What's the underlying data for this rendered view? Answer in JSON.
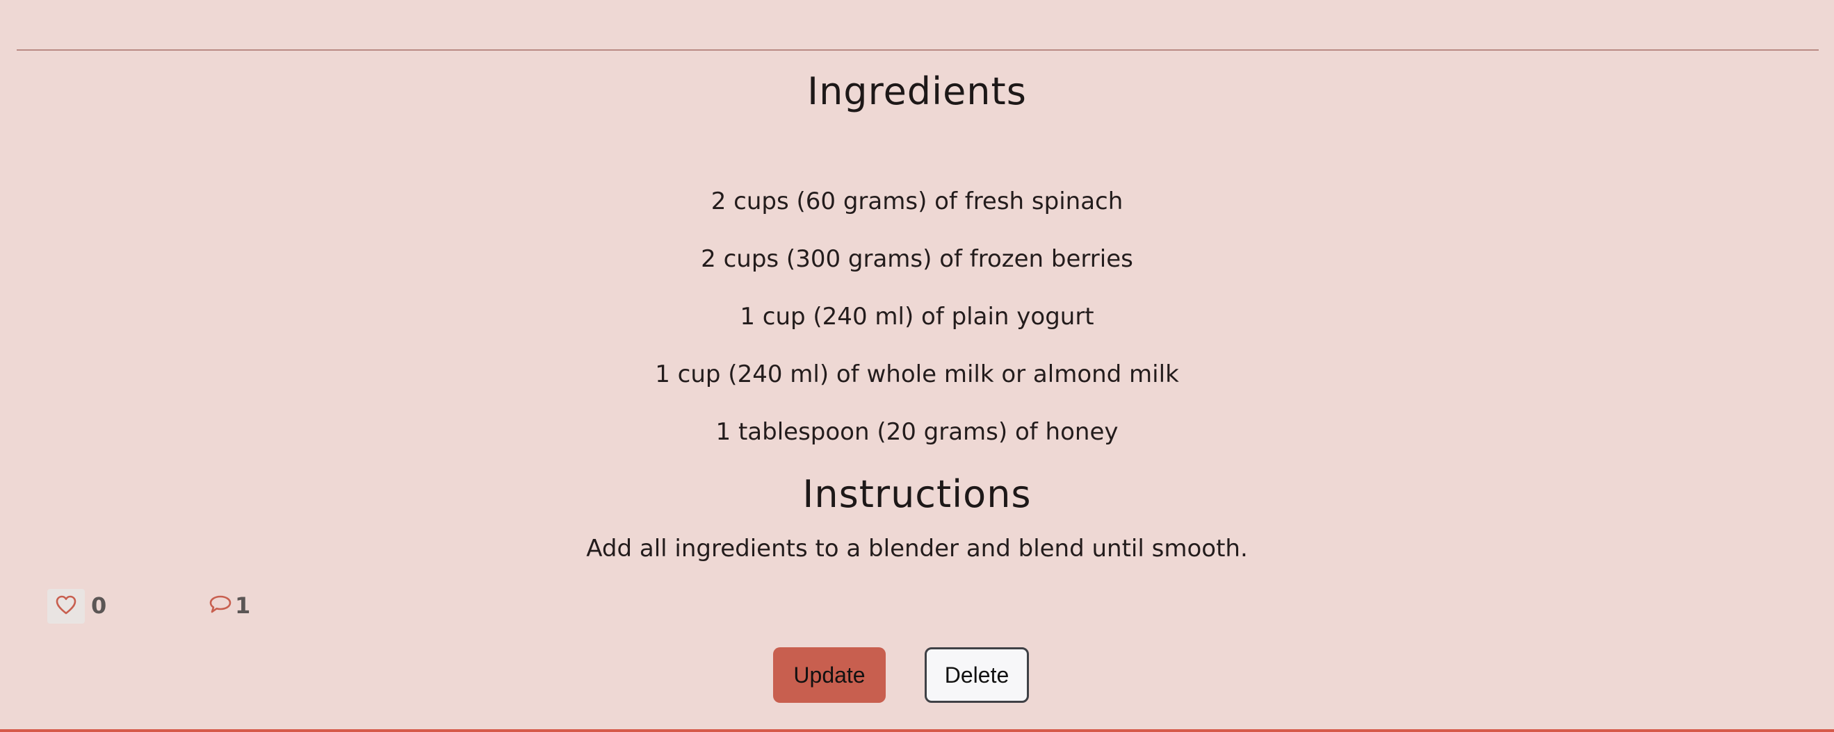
{
  "ingredients": {
    "title": "Ingredients",
    "items": [
      {
        "text": "2 cups (60 grams) of fresh spinach"
      },
      {
        "text": "2 cups (300 grams) of frozen berries"
      },
      {
        "text": "1 cup (240 ml) of plain yogurt"
      },
      {
        "text": "1 cup (240 ml) of whole milk or almond milk"
      },
      {
        "text": "1 tablespoon (20 grams) of honey"
      }
    ]
  },
  "instructions": {
    "title": "Instructions",
    "text": "Add all ingredients to a blender and blend until smooth."
  },
  "reactions": {
    "like_icon": "heart-icon",
    "like_count": "0",
    "comment_icon": "speech-bubble-icon",
    "comment_count": "1"
  },
  "actions": {
    "update_label": "Update",
    "delete_label": "Delete"
  },
  "colors": {
    "background": "#eed8d4",
    "accent": "#c85f4f",
    "divider": "#b98a84"
  }
}
